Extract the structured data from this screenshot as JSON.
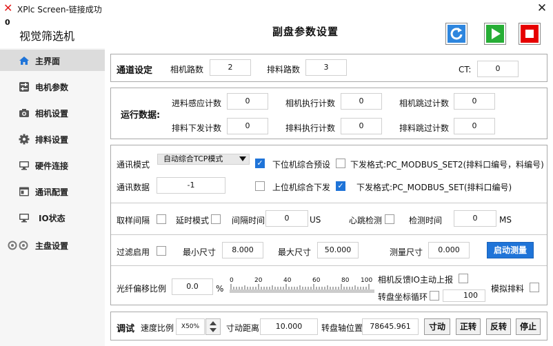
{
  "window": {
    "title": "XPlc Screen-链接成功",
    "close_glyph": "✕",
    "counter": "0"
  },
  "app_name": "视觉筛选机",
  "page_title": "副盘参数设置",
  "toolbar": {
    "refresh_color": "#2e86de",
    "start_color": "#27ae36",
    "stop_color": "#e60000"
  },
  "sidebar": {
    "items": [
      {
        "label": "主界面",
        "icon": "home-icon"
      },
      {
        "label": "电机参数",
        "icon": "sliders-icon"
      },
      {
        "label": "相机设置",
        "icon": "camera-icon"
      },
      {
        "label": "排料设置",
        "icon": "gear-icon"
      },
      {
        "label": "硬件连接",
        "icon": "monitor-icon"
      },
      {
        "label": "通讯配置",
        "icon": "window-icon"
      },
      {
        "label": "IO状态",
        "icon": "monitor-icon"
      },
      {
        "label": "主盘设置",
        "icon": "dual-gear-icon"
      }
    ]
  },
  "channel": {
    "title": "通道设定",
    "camera_label": "相机路数",
    "camera_value": "2",
    "discharge_label": "排料路数",
    "discharge_value": "3",
    "ct_label": "CT:",
    "ct_value": "0"
  },
  "runtime": {
    "title": "运行数据:",
    "row1": [
      {
        "label": "进料感应计数",
        "value": "0"
      },
      {
        "label": "相机执行计数",
        "value": "0"
      },
      {
        "label": "相机跳过计数",
        "value": "0"
      }
    ],
    "row2": [
      {
        "label": "排料下发计数",
        "value": "0"
      },
      {
        "label": "排料执行计数",
        "value": "0"
      },
      {
        "label": "排料跳过计数",
        "value": "0"
      }
    ]
  },
  "comm": {
    "mode_label": "通讯模式",
    "mode_value": "自动综合TCP模式",
    "preset_label": "下位机综合预设",
    "format2_label": "下发格式:PC_MODBUS_SET2(排料口编号，料编号)",
    "data_label": "通讯数据",
    "data_value": "-1",
    "upper_label": "上位机综合下发",
    "format_label": "下发格式:PC_MODBUS_SET(排料口编号)"
  },
  "sampling": {
    "interval_label": "取样间隔",
    "delay_label": "延时模式",
    "gap_label": "间隔时间",
    "gap_value": "0",
    "gap_unit": "US",
    "heartbeat_label": "心跳检测",
    "detect_label": "检测时间",
    "detect_value": "0",
    "detect_unit": "MS"
  },
  "filter": {
    "enable_label": "过滤启用",
    "min_label": "最小尺寸",
    "min_value": "8.000",
    "max_label": "最大尺寸",
    "max_value": "50.000",
    "measure_label": "测量尺寸",
    "measure_value": "0.000",
    "start_measure": "启动测量"
  },
  "fiber": {
    "label": "光纤偏移比例",
    "value": "0.0",
    "unit": "%",
    "ruler_ticks": [
      "0",
      "20",
      "40",
      "60",
      "80",
      "100"
    ],
    "feedback_label": "相机反馈IO主动上报",
    "loop_label": "转盘坐标循环",
    "loop_value": "100",
    "sim_label": "模拟排料"
  },
  "debug": {
    "title": "调试",
    "speed_label": "速度比例",
    "speed_value": "X50%",
    "jog_dist_label": "寸动距离",
    "jog_dist_value": "10.000",
    "axis_label": "转盘轴位置",
    "axis_value": "78645.961",
    "jog_btn": "寸动",
    "fwd_btn": "正转",
    "rev_btn": "反转",
    "stop_btn": "停止"
  }
}
